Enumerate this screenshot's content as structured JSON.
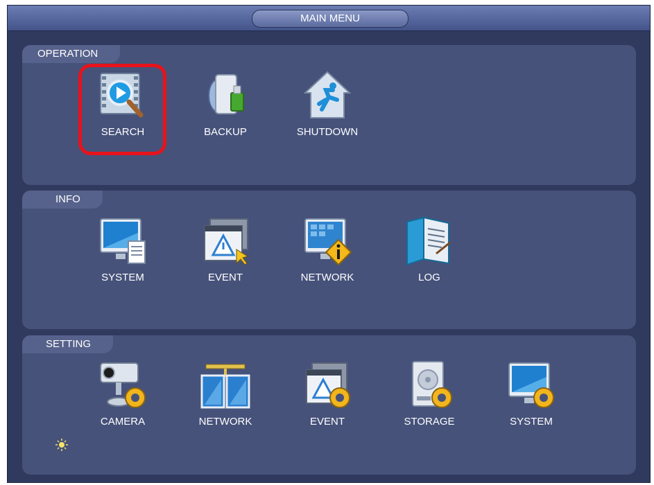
{
  "window": {
    "title": "MAIN MENU"
  },
  "sections": [
    {
      "label": "OPERATION",
      "items": [
        {
          "label": "SEARCH",
          "icon": "search-video-icon",
          "highlighted": true
        },
        {
          "label": "BACKUP",
          "icon": "backup-usb-icon"
        },
        {
          "label": "SHUTDOWN",
          "icon": "shutdown-house-icon"
        }
      ]
    },
    {
      "label": "INFO",
      "items": [
        {
          "label": "SYSTEM",
          "icon": "system-info-monitor-icon"
        },
        {
          "label": "EVENT",
          "icon": "event-warning-icon"
        },
        {
          "label": "NETWORK",
          "icon": "network-info-icon"
        },
        {
          "label": "LOG",
          "icon": "log-book-icon"
        }
      ]
    },
    {
      "label": "SETTING",
      "items": [
        {
          "label": "CAMERA",
          "icon": "camera-settings-icon"
        },
        {
          "label": "NETWORK",
          "icon": "network-settings-icon"
        },
        {
          "label": "EVENT",
          "icon": "event-settings-icon"
        },
        {
          "label": "STORAGE",
          "icon": "storage-settings-icon"
        },
        {
          "label": "SYSTEM",
          "icon": "system-settings-icon"
        }
      ]
    }
  ],
  "colors": {
    "background": "#2f3a5e",
    "section": "#46527a",
    "highlight": "#e8131b",
    "gear": "#f2b51c"
  }
}
